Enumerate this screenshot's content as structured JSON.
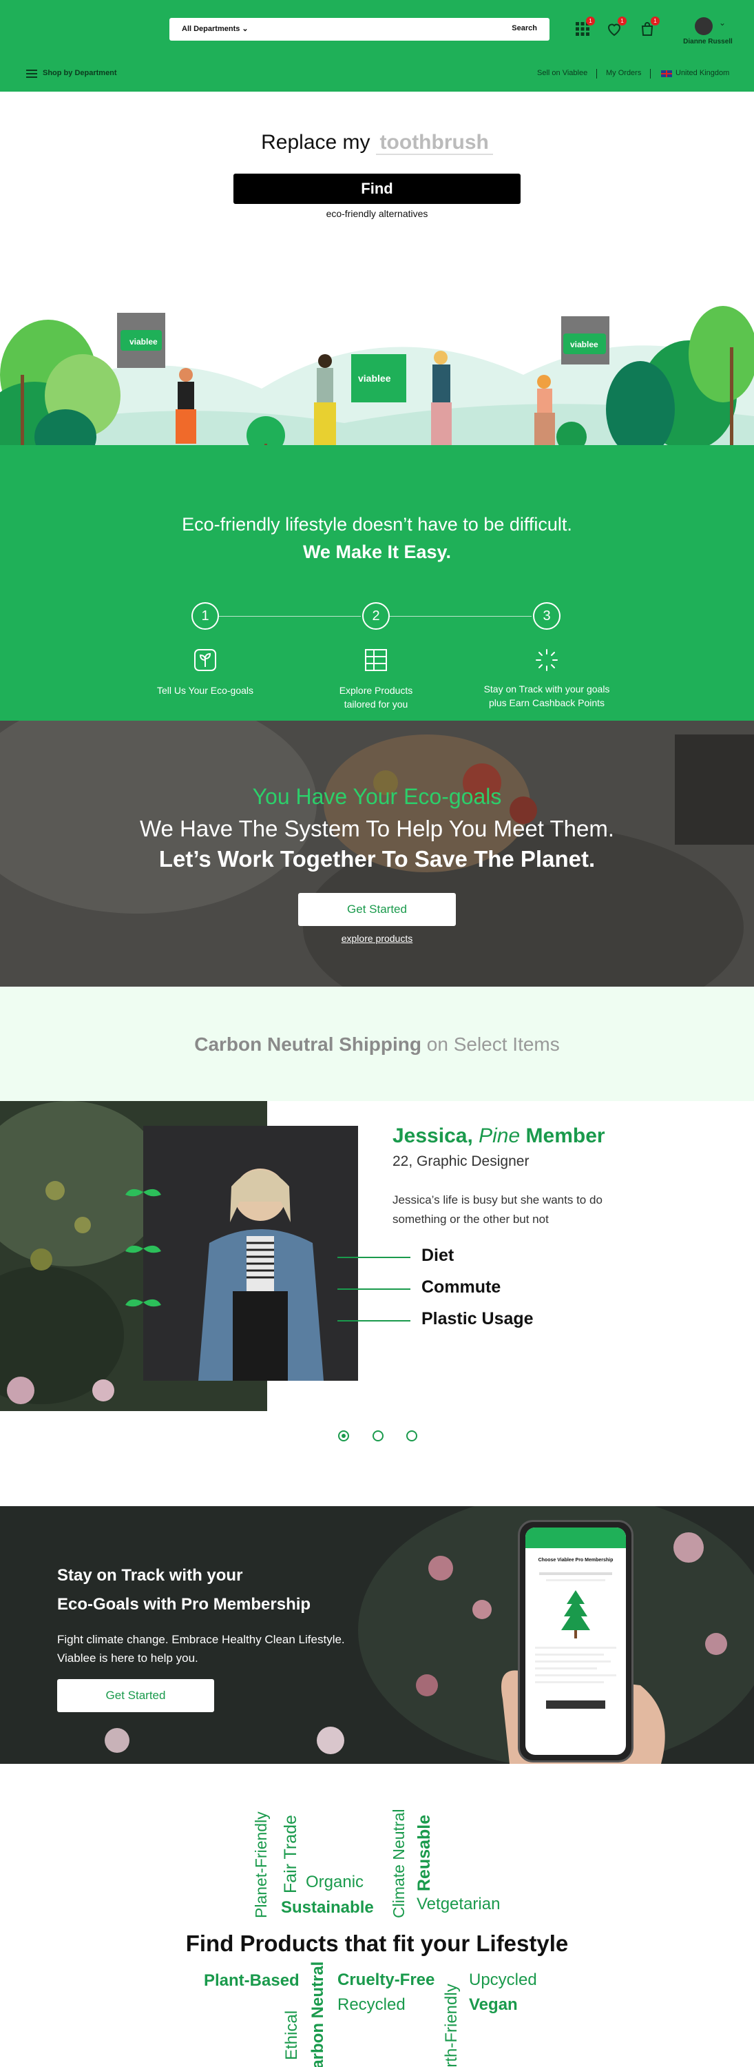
{
  "header": {
    "search": {
      "department": "All Departments",
      "button": "Search"
    },
    "badges": {
      "apps": "1",
      "wishlist": "1",
      "cart": "1"
    },
    "user_name": "Dianne Russell",
    "shop_by_department": "Shop by Department",
    "links": {
      "sell": "Sell on Viablee",
      "orders": "My Orders",
      "region": "United Kingdom"
    }
  },
  "replace": {
    "prefix": "Replace my",
    "placeholder": "toothbrush",
    "find_button": "Find",
    "subtitle": "eco-friendly alternatives"
  },
  "hero": {
    "brand": "viablee",
    "line1": "Eco-friendly lifestyle doesn’t have to be difficult.",
    "line2": "We Make It Easy.",
    "steps": [
      {
        "num": "1",
        "label": "Tell Us Your Eco-goals",
        "label2": ""
      },
      {
        "num": "2",
        "label": "Explore Products",
        "label2": "tailored for you"
      },
      {
        "num": "3",
        "label": "Stay on Track with your goals",
        "label2": "plus Earn Cashback Points"
      }
    ]
  },
  "goals_banner": {
    "line1": "You Have Your Eco-goals",
    "line2": "We Have The System To Help You Meet Them.",
    "line3": "Let’s Work Together To Save The Planet.",
    "button": "Get Started",
    "link": "explore products"
  },
  "carbon": {
    "bold": "Carbon Neutral Shipping",
    "rest": "on Select Items"
  },
  "persona": {
    "name": "Jessica,",
    "tier": "Pine",
    "member": "Member",
    "role": "22, Graphic Designer",
    "desc": "Jessica’s life is busy but she wants to do something or the other but not",
    "features": [
      "Diet",
      "Commute",
      "Plastic Usage"
    ]
  },
  "pro": {
    "title1": "Stay on Track with your",
    "title2": "Eco-Goals with Pro Membership",
    "desc1": "Fight climate change. Embrace Healthy Clean Lifestyle.",
    "desc2": "Viablee is here to help you.",
    "button": "Get Started",
    "phone_title": "Choose Viablee Pro Membership"
  },
  "lifestyle": {
    "heading": "Find Products that fit your Lifestyle",
    "words_top": {
      "planet": "Planet-Friendly",
      "fair": "Fair Trade",
      "organic": "Organic",
      "sustainable": "Sustainable",
      "climate": "Climate Neutral",
      "reusable": "Reusable",
      "vetgetarian": "Vetgetarian"
    },
    "words_bottom": {
      "plant": "Plant-Based",
      "ethical": "Ethical",
      "carbon": "Carbon Neutral",
      "cruelty": "Cruelty-Free",
      "recycled": "Recycled",
      "earth": "Earth-Friendly",
      "upcycled": "Upcycled",
      "vegan": "Vegan"
    }
  },
  "colors": {
    "brand_green": "#1fb058",
    "dark_green": "#1a9a4c",
    "light_green_bg": "#effdf2"
  }
}
